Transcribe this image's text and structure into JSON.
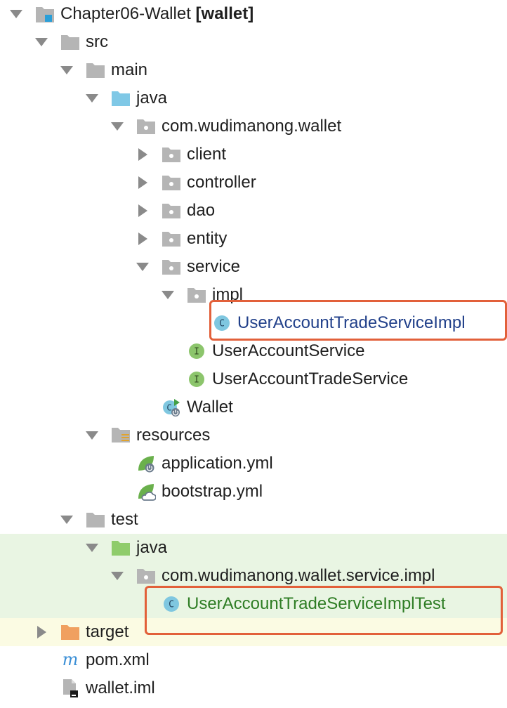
{
  "tree": {
    "project": {
      "name": "Chapter06-Wallet",
      "module": "[wallet]"
    },
    "src": "src",
    "main": "main",
    "main_java": "java",
    "package": "com.wudimanong.wallet",
    "packages": [
      "client",
      "controller",
      "dao",
      "entity"
    ],
    "service": "service",
    "impl": "impl",
    "impl_class": "UserAccountTradeServiceImpl",
    "interfaces": [
      "UserAccountService",
      "UserAccountTradeService"
    ],
    "app_class": "Wallet",
    "resources": "resources",
    "config_files": [
      "application.yml",
      "bootstrap.yml"
    ],
    "test": "test",
    "test_java": "java",
    "test_package": "com.wudimanong.wallet.service.impl",
    "test_class": "UserAccountTradeServiceImplTest",
    "target": "target",
    "pom": "pom.xml",
    "iml": "wallet.iml"
  },
  "icon_glyphs": {
    "class": "C",
    "interface": "I",
    "maven": "m"
  },
  "colors": {
    "folder": "#b5b5b5",
    "source_folder": "#7fc8e6",
    "test_folder": "#8fcc6b",
    "excluded_folder": "#f0a060",
    "class_icon": "#7fc7e0",
    "interface_icon": "#8cc56c",
    "spring_leaf": "#6ab04c",
    "highlight": "#e2603a",
    "test_band": "#e9f5e3",
    "excluded_band": "#fbfbe3"
  }
}
